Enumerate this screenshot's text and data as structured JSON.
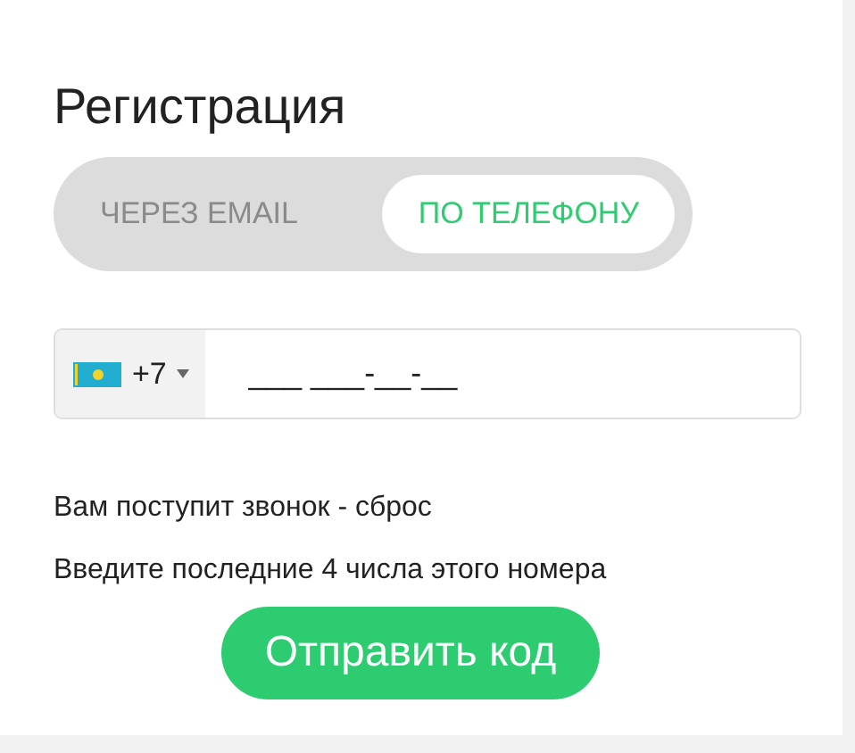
{
  "title": "Регистрация",
  "tabs": [
    {
      "label": "ЧЕРЕЗ EMAIL",
      "selected": false
    },
    {
      "label": "ПО ТЕЛЕФОНУ",
      "selected": true
    }
  ],
  "phone": {
    "code": "+7",
    "placeholder": "___ ___-__-__"
  },
  "notes": [
    "Вам поступит звонок - сброс",
    "Введите последние 4 числа этого номера"
  ],
  "submit": "Отправить код"
}
